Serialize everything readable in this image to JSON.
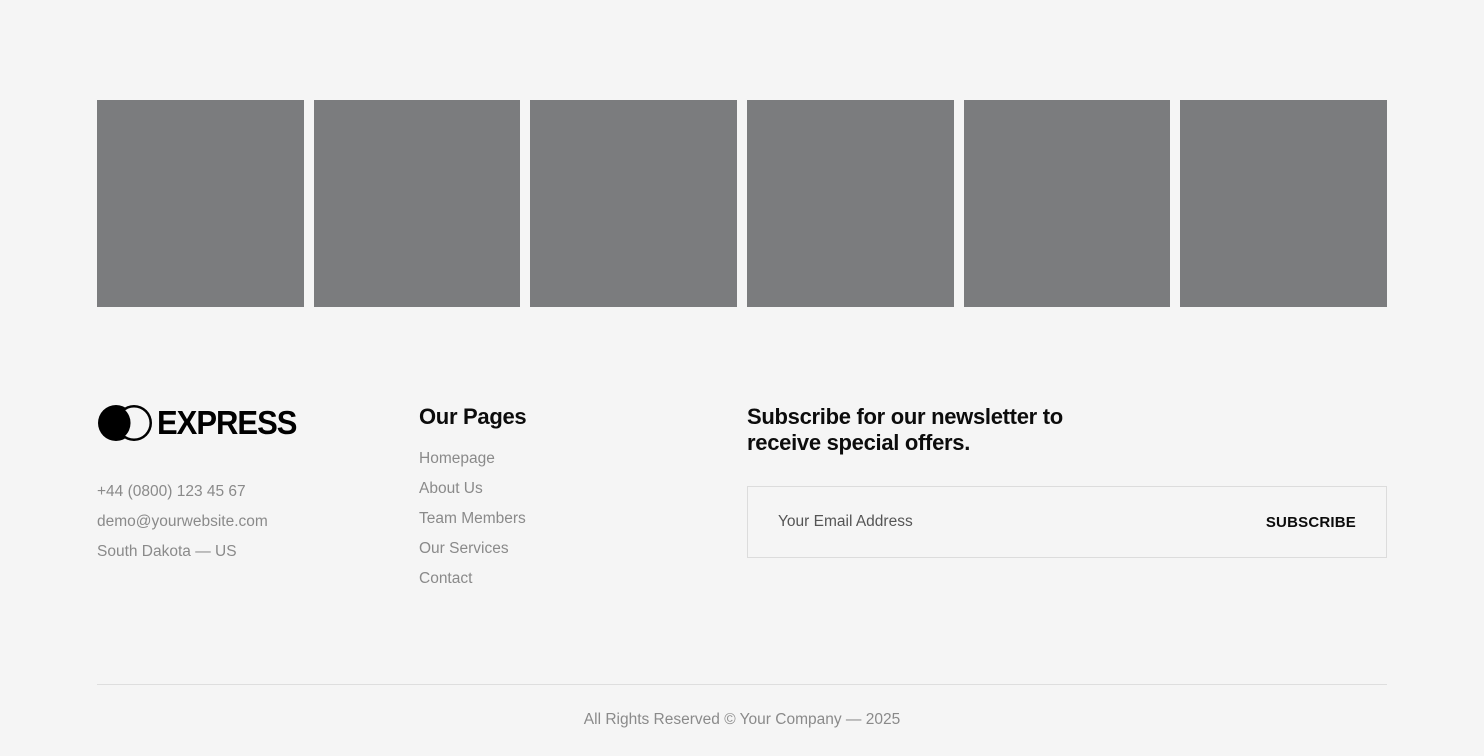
{
  "gallery": {
    "tiles": [
      "tile",
      "tile",
      "tile",
      "tile",
      "tile",
      "tile"
    ]
  },
  "brand": {
    "logo_text": "EXPRESS",
    "phone": "+44 (0800) 123 45 67",
    "email": "demo@yourwebsite.com",
    "location": "South Dakota — US"
  },
  "pages": {
    "heading": "Our Pages",
    "links": [
      {
        "label": "Homepage"
      },
      {
        "label": "About Us"
      },
      {
        "label": "Team Members"
      },
      {
        "label": "Our Services"
      },
      {
        "label": "Contact"
      }
    ]
  },
  "newsletter": {
    "heading": "Subscribe for our newsletter to receive special offers.",
    "email_placeholder": "Your Email Address",
    "subscribe_label": "SUBSCRIBE"
  },
  "footer": {
    "copyright": "All Rights Reserved © Your Company — 2025"
  },
  "colors": {
    "background": "#f5f5f5",
    "tile": "#7b7c7e",
    "muted_text": "#8a8a8a",
    "heading_text": "#0c0c0c"
  }
}
